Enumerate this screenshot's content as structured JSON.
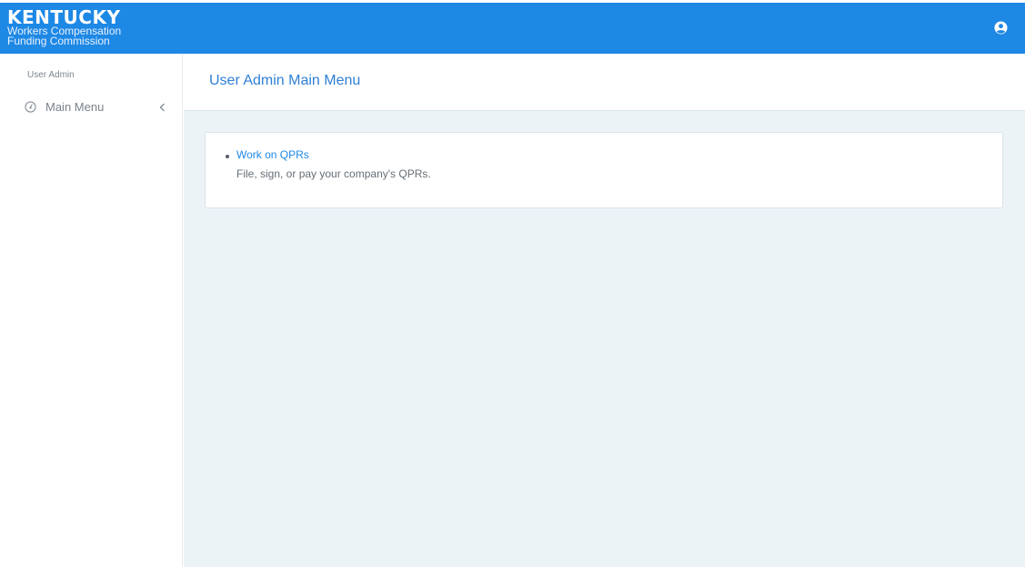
{
  "brand": {
    "title": "KENTUCKY",
    "subtitle_line1": "Workers Compensation",
    "subtitle_line2": "Funding Commission"
  },
  "topbar": {
    "color": "#1e88e5",
    "user_icon": "user-circle-icon"
  },
  "sidebar": {
    "heading": "User Admin",
    "items": [
      {
        "label": "Main Menu",
        "icon": "dashboard-icon",
        "chevron": "chevron-left-icon"
      }
    ]
  },
  "main": {
    "title": "User Admin Main Menu",
    "links": [
      {
        "label": "Work on QPRs",
        "description": "File, sign, or pay your company's QPRs."
      }
    ]
  }
}
